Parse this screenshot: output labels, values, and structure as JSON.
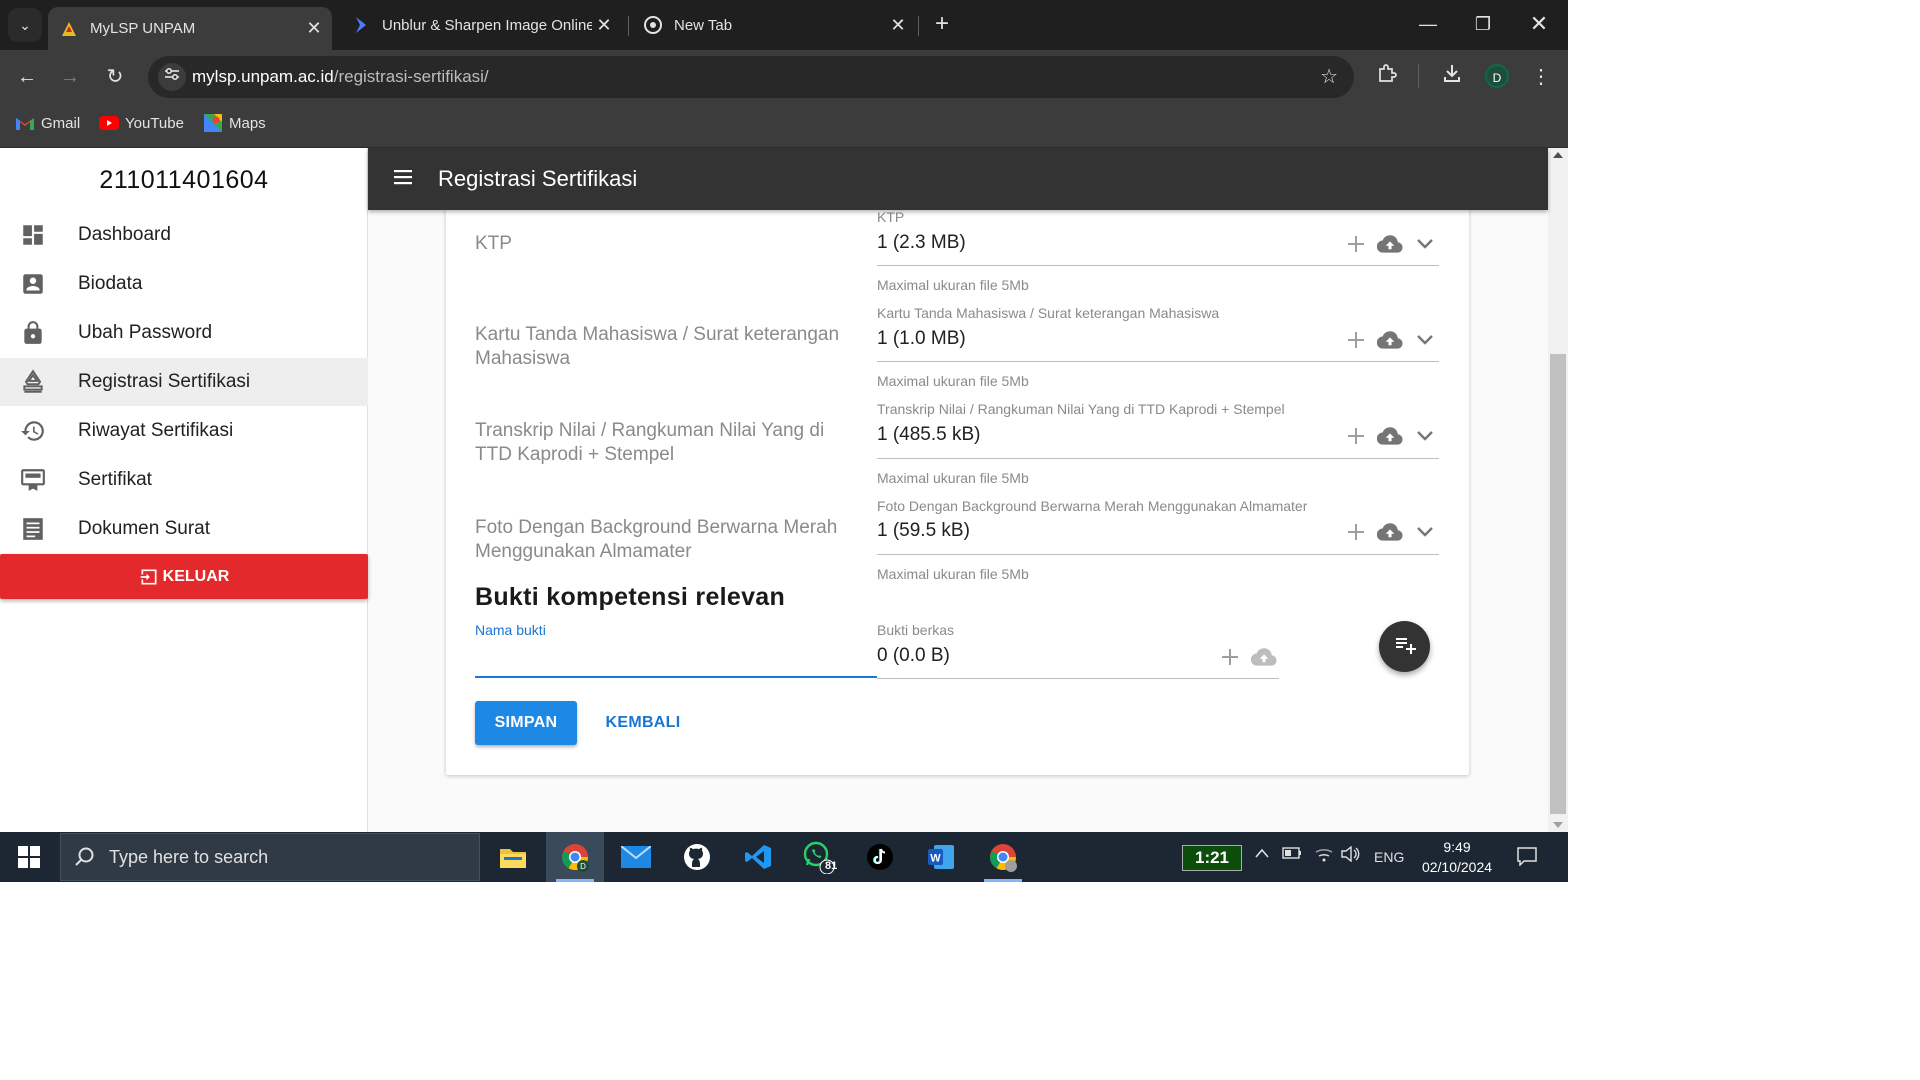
{
  "browser": {
    "tabs": [
      {
        "title": "MyLSP UNPAM",
        "active": true
      },
      {
        "title": "Unblur & Sharpen Image Online",
        "active": false
      },
      {
        "title": "New Tab",
        "active": false
      }
    ],
    "url_host": "mylsp.unpam.ac.id",
    "url_path": "/registrasi-sertifikasi/",
    "profile_initial": "D",
    "bookmarks": [
      "Gmail",
      "YouTube",
      "Maps"
    ]
  },
  "sidebar": {
    "user_id": "211011401604",
    "items": [
      {
        "label": "Dashboard",
        "icon": "dashboard-icon"
      },
      {
        "label": "Biodata",
        "icon": "account-box-icon"
      },
      {
        "label": "Ubah Password",
        "icon": "lock-icon"
      },
      {
        "label": "Registrasi Sertifikasi",
        "icon": "stamp-icon"
      },
      {
        "label": "Riwayat Sertifikasi",
        "icon": "history-icon"
      },
      {
        "label": "Sertifikat",
        "icon": "certificate-icon"
      },
      {
        "label": "Dokumen Surat",
        "icon": "document-list-icon"
      }
    ],
    "logout_label": "KELUAR"
  },
  "appbar": {
    "title": "Registrasi Sertifikasi"
  },
  "documents": [
    {
      "label": "KTP",
      "caption": "KTP",
      "value": "1 (2.3 MB)",
      "hint": "Maximal ukuran file 5Mb"
    },
    {
      "label": "Kartu Tanda Mahasiswa / Surat keterangan Mahasiswa",
      "caption": "Kartu Tanda Mahasiswa / Surat keterangan Mahasiswa",
      "value": "1 (1.0 MB)",
      "hint": "Maximal ukuran file 5Mb"
    },
    {
      "label": "Transkrip Nilai / Rangkuman Nilai Yang di TTD Kaprodi + Stempel",
      "caption": "Transkrip Nilai / Rangkuman Nilai Yang di TTD Kaprodi + Stempel",
      "value": "1 (485.5 kB)",
      "hint": "Maximal ukuran file 5Mb"
    },
    {
      "label": "Foto Dengan Background Berwarna Merah Menggunakan Almamater",
      "caption": "Foto Dengan Background Berwarna Merah Menggunakan Almamater",
      "value": "1 (59.5 kB)",
      "hint": "Maximal ukuran file 5Mb"
    }
  ],
  "competence": {
    "section_title": "Bukti kompetensi relevan",
    "name_caption": "Nama bukti",
    "name_value": "",
    "file_caption": "Bukti berkas",
    "file_value": "0 (0.0 B)"
  },
  "actions": {
    "save": "SIMPAN",
    "back": "KEMBALI"
  },
  "taskbar": {
    "search_placeholder": "Type here to search",
    "battery": "1:21",
    "whatsapp_badge": "81",
    "language": "ENG",
    "time": "9:49",
    "date": "02/10/2024"
  },
  "colors": {
    "accent": "#1e88e5",
    "logout": "#e3292c",
    "appbar": "#333333"
  }
}
